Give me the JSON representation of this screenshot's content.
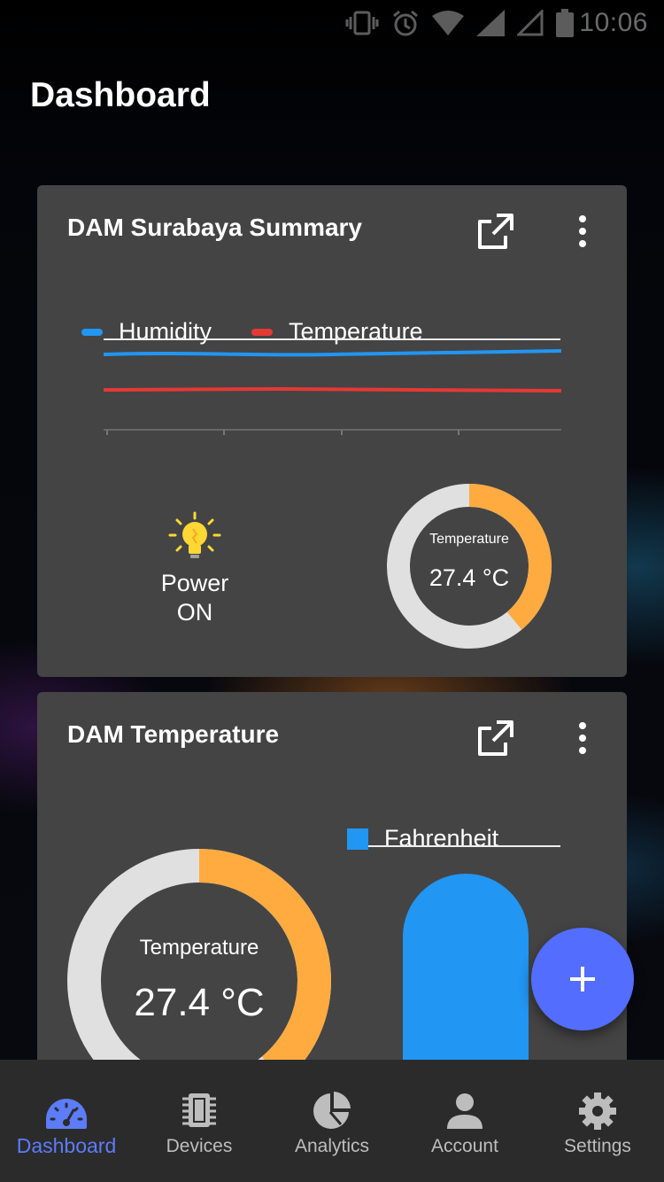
{
  "status_bar": {
    "time": "10:06"
  },
  "page_title": "Dashboard",
  "colors": {
    "card": "#444444",
    "humidity": "#2196f3",
    "temperature": "#e53935",
    "gauge_value": "#ffab40",
    "gauge_track": "#e0e0e0",
    "accent": "#536dfe",
    "bulb": "#fdd835"
  },
  "card1": {
    "title": "DAM Surabaya Summary",
    "chart_data": {
      "type": "line",
      "legend": [
        "Humidity",
        "Temperature"
      ],
      "series": [
        {
          "name": "Humidity",
          "color": "#2196f3"
        },
        {
          "name": "Temperature",
          "color": "#e53935"
        }
      ]
    },
    "power": {
      "label": "Power",
      "state": "ON"
    },
    "gauge": {
      "label": "Temperature",
      "value_text": "27.4 °C",
      "fraction": 0.39
    }
  },
  "card2": {
    "title": "DAM Temperature",
    "gauge": {
      "label": "Temperature",
      "value_text": "27.4 °C",
      "fraction": 0.39
    },
    "bar": {
      "legend": "Fahrenheit",
      "color": "#2196f3"
    }
  },
  "fab": {
    "icon": "plus-icon"
  },
  "nav": [
    {
      "label": "Dashboard",
      "icon": "dashboard-icon",
      "active": true
    },
    {
      "label": "Devices",
      "icon": "chip-icon",
      "active": false
    },
    {
      "label": "Analytics",
      "icon": "pie-chart-icon",
      "active": false
    },
    {
      "label": "Account",
      "icon": "account-icon",
      "active": false
    },
    {
      "label": "Settings",
      "icon": "gear-icon",
      "active": false
    }
  ]
}
